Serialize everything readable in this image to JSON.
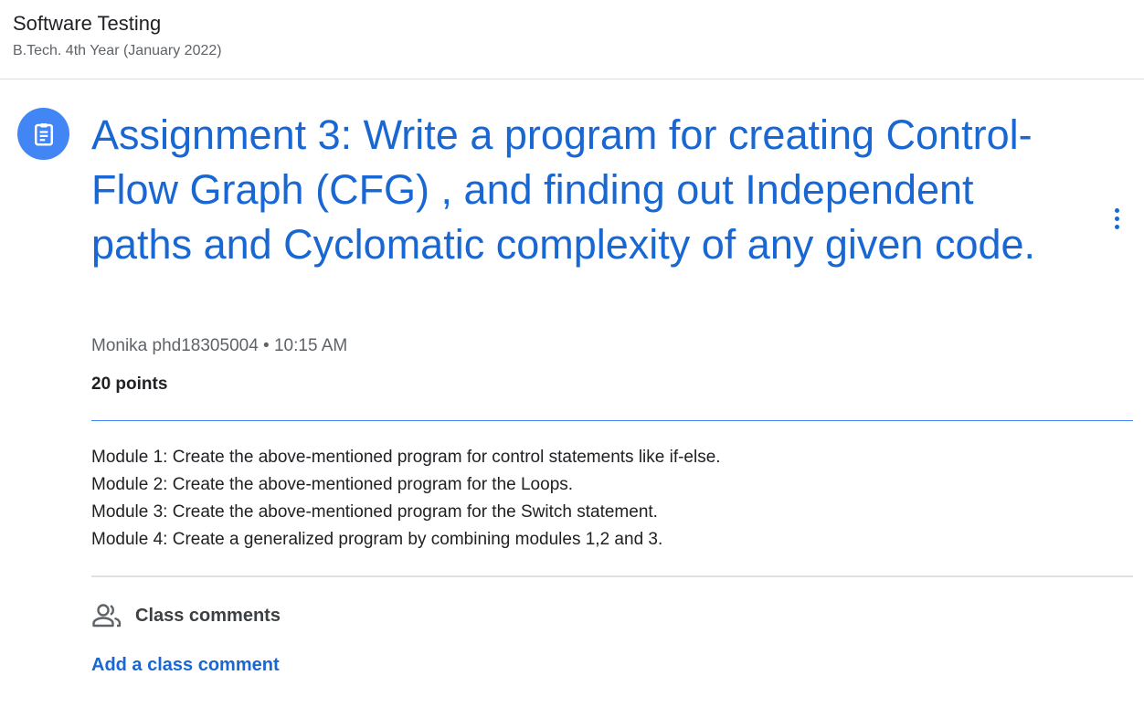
{
  "header": {
    "course_title": "Software Testing",
    "course_section": "B.Tech. 4th Year (January 2022)"
  },
  "assignment": {
    "icon": "assignment-icon",
    "title": "Assignment 3: Write a program for creating Control-Flow Graph (CFG) , and finding out Independent paths and Cyclomatic complexity of any given code.",
    "author": "Monika phd18305004",
    "separator": " • ",
    "time": "10:15 AM",
    "points": "20 points",
    "more_icon": "more-vert-icon",
    "modules": [
      "Module 1: Create the above-mentioned program for control statements like if-else.",
      "Module 2: Create the above-mentioned program for the Loops.",
      "Module 3: Create the above-mentioned program for the Switch statement.",
      "Module 4: Create a generalized program by combining modules 1,2 and 3."
    ]
  },
  "comments": {
    "icon": "people-icon",
    "label": "Class comments",
    "add_label": "Add a class comment"
  },
  "colors": {
    "accent": "#1967d2",
    "icon_bg": "#4285f4",
    "divider": "#4285f4"
  }
}
